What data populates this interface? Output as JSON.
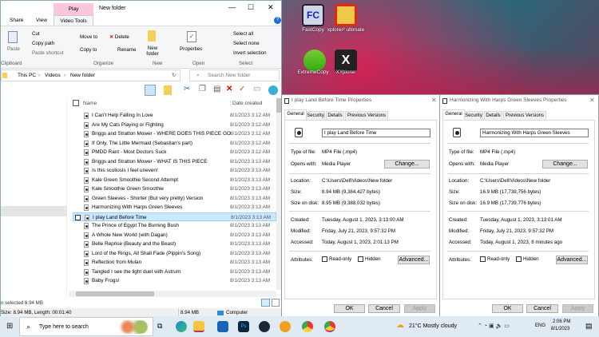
{
  "explorer": {
    "title": "New folder",
    "context_tab": "Play",
    "tabs": [
      "Share",
      "View",
      "Video Tools"
    ],
    "ribbon": {
      "clipboard": {
        "paste": "Paste",
        "cut": "Cut",
        "copy_path": "Copy path",
        "paste_shortcut": "Paste shortcut",
        "group": "Clipboard"
      },
      "organize": {
        "move_to": "Move to",
        "copy_to": "Copy to",
        "delete": "Delete",
        "rename": "Rename",
        "group": "Organize"
      },
      "new": {
        "new_folder": "New folder",
        "group": "New"
      },
      "open": {
        "properties": "Properties",
        "group": "Open"
      },
      "select": {
        "select_all": "Select all",
        "select_none": "Select none",
        "invert": "Invert selection",
        "group": "Select"
      }
    },
    "breadcrumb": [
      "This PC",
      "Videos",
      "New folder"
    ],
    "search_placeholder": "Search New folder",
    "columns": {
      "name": "Name",
      "date": "Date created"
    },
    "files": [
      {
        "name": "I Can't Help Falling In Love",
        "date": "8/1/2023 3:12 AM"
      },
      {
        "name": "Are My Cats Playing or Fighting",
        "date": "8/1/2023 3:12 AM"
      },
      {
        "name": "Briggs and Stratton Mower - WHERE DOES THIS PIECE GO",
        "date": "8/1/2023 3:12 AM"
      },
      {
        "name": "If Only, The Little Mermaid (Sebastian's part)",
        "date": "8/1/2023 3:12 AM"
      },
      {
        "name": "PMDD Rant - Most Doctors Suck",
        "date": "8/1/2023 3:12 AM"
      },
      {
        "name": "Briggs and Stratton Mower - WHAT IS THIS PIECE",
        "date": "8/1/2023 3:13 AM"
      },
      {
        "name": "Is this scoliosis  I feel uneven!",
        "date": "8/1/2023 3:13 AM"
      },
      {
        "name": "Kale   Green Smoothie Second Attempt",
        "date": "8/1/2023 3:13 AM"
      },
      {
        "name": "Kale Smoothie   Green Smoothie",
        "date": "8/1/2023 3:13 AM"
      },
      {
        "name": "Green Sleeves - Shorter (But very pretty) Version",
        "date": "8/1/2023 3:13 AM"
      },
      {
        "name": "Harmonizing With Harps  Green Sleeves",
        "date": "8/1/2023 3:13 AM"
      },
      {
        "name": "I play Land Before Time",
        "date": "8/1/2023 3:13 AM"
      },
      {
        "name": "The Prince of Egypt  The Burning Bush",
        "date": "8/1/2023 3:13 AM"
      },
      {
        "name": "A Whole New World (with Dagan)",
        "date": "8/1/2023 3:13 AM"
      },
      {
        "name": "Belle Reprise (Beauty and the Beast)",
        "date": "8/1/2023 3:13 AM"
      },
      {
        "name": "Lord of the Rings, All Shall Fade (Pippin's Song)",
        "date": "8/1/2023 3:13 AM"
      },
      {
        "name": "Reflection from Mulan",
        "date": "8/1/2023 3:13 AM"
      },
      {
        "name": "Tangled  I see the light  duet with Astrum",
        "date": "8/1/2023 3:13 AM"
      },
      {
        "name": "Baby Frogs!",
        "date": "8/1/2023 3:13 AM"
      }
    ],
    "status": "n selected  8.94 MB",
    "details": {
      "info": "Size: 8.94 MB, Length: 00:01:40",
      "size": "8.94 MB",
      "location": "Computer"
    }
  },
  "dialogs": [
    {
      "title": "I play Land Before Time Properties",
      "tabs": [
        "General",
        "Security",
        "Details",
        "Previous Versions"
      ],
      "name": "I play Land Before Time",
      "type_label": "Type of file:",
      "type": "MP4 File (.mp4)",
      "opens_label": "Opens with:",
      "opens": "Media Player",
      "change": "Change...",
      "location_label": "Location:",
      "location": "C:\\Users\\Dell\\Videos\\New folder",
      "size_label": "Size:",
      "size": "8.94 MB (9,384,427 bytes)",
      "disk_label": "Size on disk:",
      "disk": "8.95 MB (9,388,032 bytes)",
      "created_label": "Created:",
      "created": "Tuesday, August 1, 2023, 3:13:00 AM",
      "modified_label": "Modified:",
      "modified": "Friday, July 21, 2023, 9:57:32 PM",
      "accessed_label": "Accessed:",
      "accessed": "Today, August 1, 2023, 2:01:13 PM",
      "attr_label": "Attributes:",
      "readonly": "Read-only",
      "hidden": "Hidden",
      "advanced": "Advanced...",
      "ok": "OK",
      "cancel": "Cancel",
      "apply": "Apply"
    },
    {
      "title": "Harmonizing With Harps  Green Sleeves Properties",
      "tabs": [
        "General",
        "Security",
        "Details",
        "Previous Versions"
      ],
      "name": "Harmonizing With Harps  Green Sleeves",
      "type_label": "Type of file:",
      "type": "MP4 File (.mp4)",
      "opens_label": "Opens with:",
      "opens": "Media Player",
      "change": "Change...",
      "location_label": "Location:",
      "location": "C:\\Users\\Dell\\Videos\\New folder",
      "size_label": "Size:",
      "size": "16.9 MB (17,739,756 bytes)",
      "disk_label": "Size on disk:",
      "disk": "16.9 MB (17,739,776 bytes)",
      "created_label": "Created:",
      "created": "Tuesday, August 1, 2023, 3:13:01 AM",
      "modified_label": "Modified:",
      "modified": "Friday, July 21, 2023, 9:57:32 PM",
      "accessed_label": "Accessed:",
      "accessed": "Today, August 1, 2023, 8 minutes ago",
      "attr_label": "Attributes:",
      "readonly": "Read-only",
      "hidden": "Hidden",
      "advanced": "Advanced...",
      "ok": "OK",
      "cancel": "Cancel",
      "apply": "Apply"
    }
  ],
  "desktop": {
    "icons": [
      "FastCopy",
      "xplorer² ultimate",
      "ExtremeCopy",
      "XYplorer"
    ]
  },
  "taskbar": {
    "search_placeholder": "Type here to search",
    "weather": "21°C  Mostly cloudy",
    "lang": "ENG",
    "time": "2:06 PM",
    "date": "8/1/2023"
  }
}
